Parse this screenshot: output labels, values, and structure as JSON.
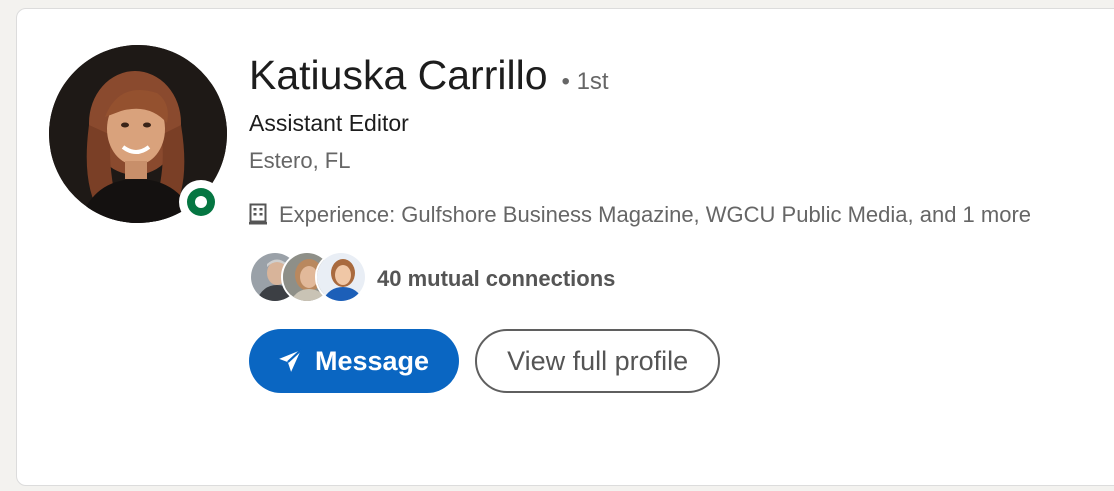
{
  "profile": {
    "name": "Katiuska Carrillo",
    "degree": "• 1st",
    "headline": "Assistant Editor",
    "location": "Estero, FL",
    "experience": "Experience: Gulfshore Business Magazine, WGCU Public Media, and 1 more",
    "presence": "online"
  },
  "mutual": {
    "text": "40 mutual connections",
    "avatar_count": 3
  },
  "actions": {
    "message_label": "Message",
    "view_profile_label": "View full profile"
  },
  "colors": {
    "primary": "#0a66c2",
    "online": "#057642",
    "text_primary": "#1d1d1d",
    "text_secondary": "#666666"
  },
  "icons": {
    "experience": "building-icon",
    "message": "send-icon"
  }
}
